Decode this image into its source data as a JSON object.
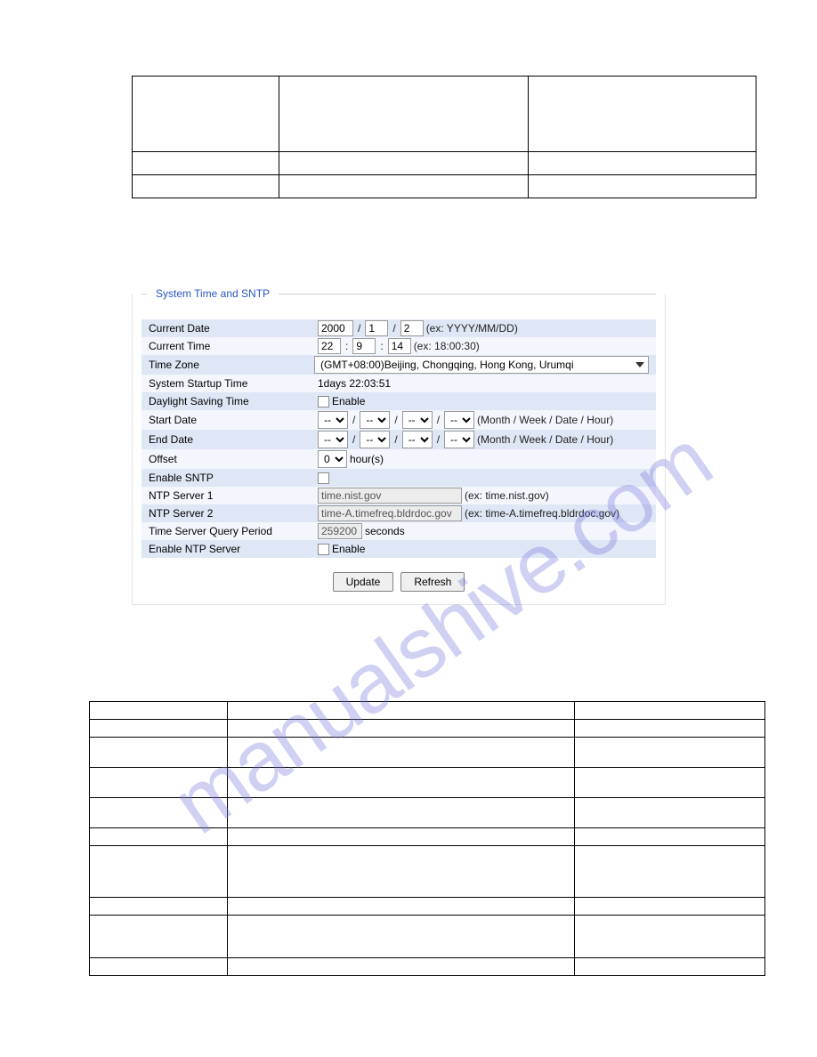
{
  "watermark": "manualshive.com",
  "panel": {
    "title": "System Time and SNTP",
    "current_date_label": "Current Date",
    "current_date": {
      "y": "2000",
      "m": "1",
      "d": "2",
      "hint": "(ex: YYYY/MM/DD)"
    },
    "current_time_label": "Current Time",
    "current_time": {
      "h": "22",
      "m": "9",
      "s": "14",
      "hint": "(ex: 18:00:30)"
    },
    "time_zone_label": "Time Zone",
    "time_zone": "(GMT+08:00)Beijing, Chongqing, Hong Kong, Urumqi",
    "startup_label": "System Startup Time",
    "startup_value": "1days 22:03:51",
    "dst_label": "Daylight Saving Time",
    "enable_text": "Enable",
    "start_date_label": "Start Date",
    "end_date_label": "End Date",
    "dash_opt": "--",
    "date_hint": "(Month / Week / Date / Hour)",
    "offset_label": "Offset",
    "offset_value": "0",
    "offset_unit": "hour(s)",
    "enable_sntp_label": "Enable SNTP",
    "ntp1_label": "NTP Server 1",
    "ntp1_value": "time.nist.gov",
    "ntp1_hint": "(ex: time.nist.gov)",
    "ntp2_label": "NTP Server 2",
    "ntp2_value": "time-A.timefreq.bldrdoc.gov",
    "ntp2_hint": "(ex: time-A.timefreq.bldrdoc.gov)",
    "query_label": "Time Server Query Period",
    "query_value": "259200",
    "query_unit": "seconds",
    "enable_ntp_server_label": "Enable NTP Server",
    "update_btn": "Update",
    "refresh_btn": "Refresh",
    "slash": "/",
    "colon": ":"
  }
}
